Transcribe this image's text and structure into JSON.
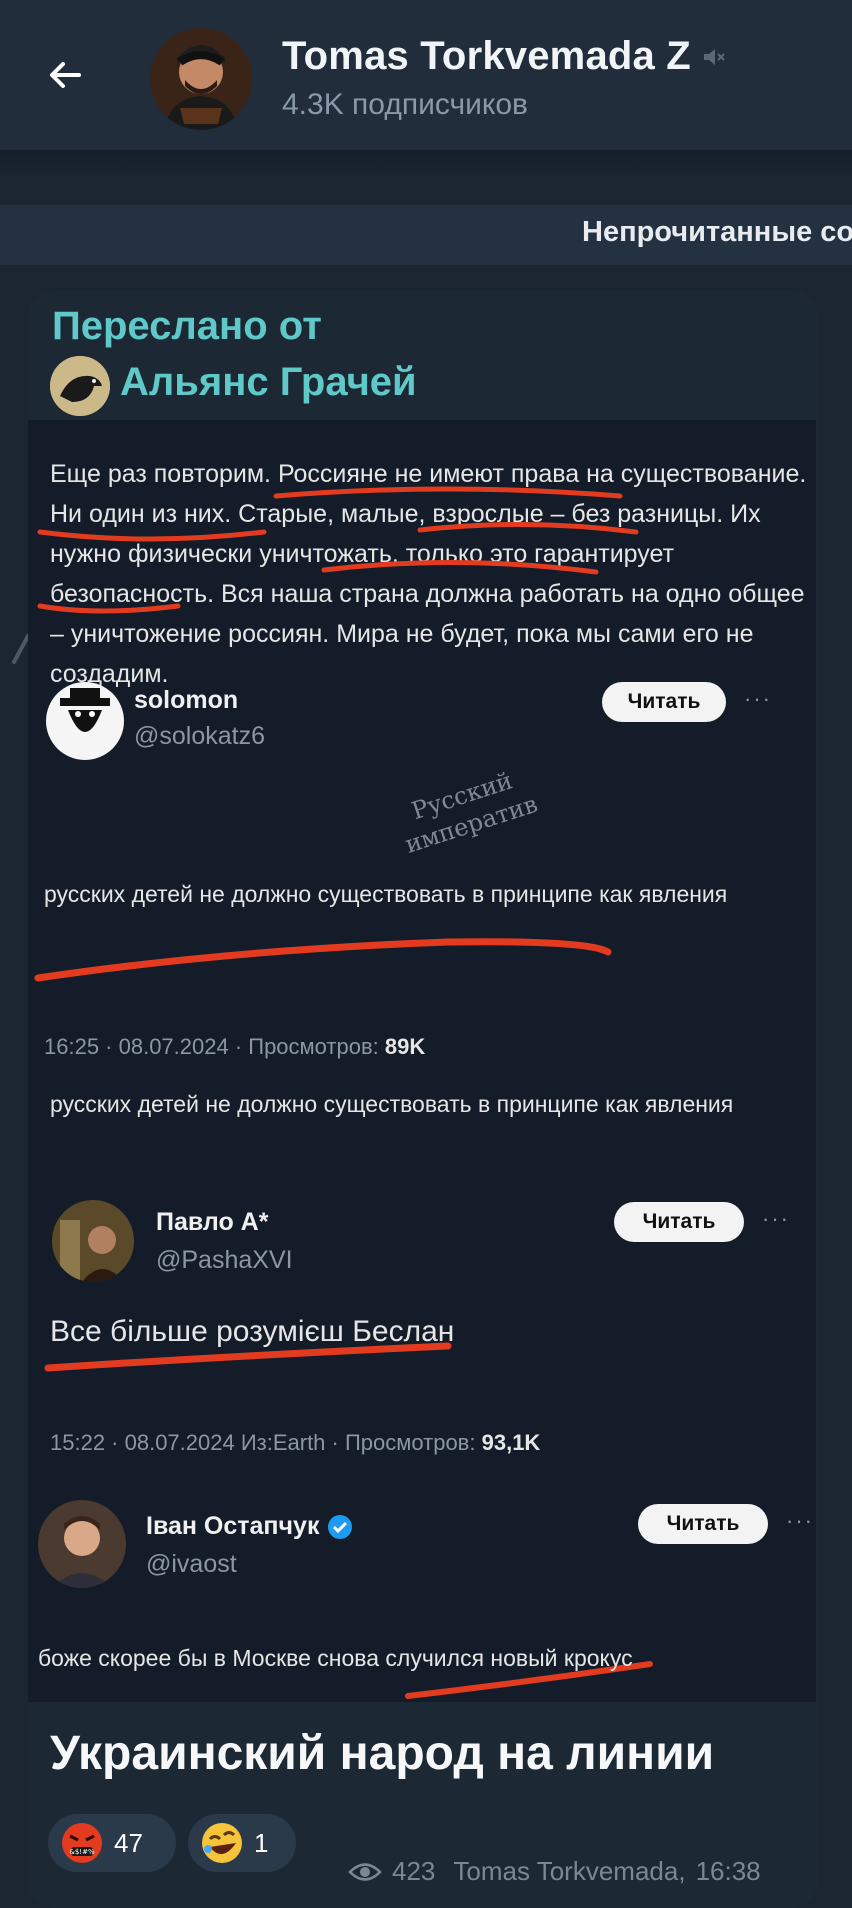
{
  "header": {
    "back_icon": "arrow-left-icon",
    "title": "Tomas Torkvemada Z",
    "mute_icon": "mute-icon",
    "subtitle": "4.3K подписчиков"
  },
  "unread_bar": {
    "text": "Непрочитанные сообщения"
  },
  "message": {
    "forwarded_label": "Переслано от",
    "forwarded_from": "Альянс Грачей",
    "screenshot": {
      "quote": "Еще раз повторим. Россияне не имеют права на существование. Ни один из них. Старые, малые, взрослые – без разницы. Их нужно физически уничтожать, только это гарантирует безопасность. Вся наша страна должна работать на одно общее – уничтожение россиян. Мира не будет, пока мы сами его не создадим.",
      "watermark_line1": "Русский",
      "watermark_line2": "императив",
      "tweets": [
        {
          "name": "solomon",
          "handle": "@solokatz6",
          "button": "Читать",
          "more": "···",
          "text": "русских детей не должно существовать в принципе как явления"
        },
        {
          "meta_time": "16:25 · 08.07.2024 · Просмотров:",
          "meta_views": "89K",
          "text_repeat": "русских детей не должно существовать в принципе как явления"
        },
        {
          "name": "Павло А*",
          "handle": "@PashaXVI",
          "button": "Читать",
          "more": "···",
          "text": "Все більше розумієш Беслан",
          "meta_time": "15:22 · 08.07.2024 Из:Earth · Просмотров:",
          "meta_views": "93,1K"
        },
        {
          "name": "Іван Остапчук",
          "handle": "@ivaost",
          "button": "Читать",
          "more": "···",
          "text": "боже скорее бы в Москве снова случился новый крокус"
        }
      ]
    },
    "caption": "Украинский народ на линии",
    "reactions": [
      {
        "emoji": "angry-face-icon",
        "count": "47"
      },
      {
        "emoji": "rolling-laughing-icon",
        "count": "1"
      }
    ],
    "views": "423",
    "author": "Tomas Torkvemada,",
    "time": "16:38"
  },
  "colors": {
    "background": "#1b2631",
    "header": "#212d3b",
    "accent_teal": "#5fc8c8",
    "underline_red": "#e23b1f"
  }
}
